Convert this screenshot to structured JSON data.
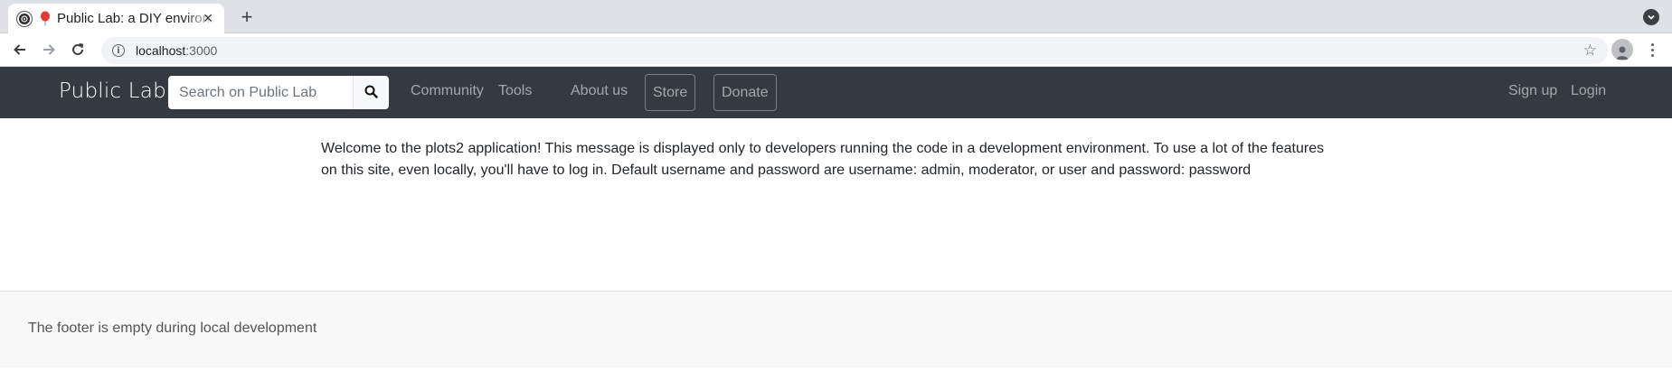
{
  "browser": {
    "tab": {
      "title": "Public Lab: a DIY environmental science community"
    },
    "address_bar": {
      "host": "localhost",
      "port": ":3000"
    }
  },
  "navbar": {
    "brand": "Public Lab",
    "search": {
      "placeholder": "Search on Public Lab"
    },
    "links": {
      "community": "Community",
      "tools": "Tools",
      "about": "About us",
      "store": "Store",
      "donate": "Donate",
      "signup": "Sign up",
      "login": "Login"
    }
  },
  "main": {
    "dev_message_line1": "Welcome to the plots2 application! This message is displayed only to developers running the code in a development environment. To use a lot of the features",
    "dev_message_line2": "on this site, even locally, you'll have to log in. Default username and password are username: admin, moderator, or user and password: password"
  },
  "footer": {
    "text": "The footer is empty during local development"
  },
  "colors": {
    "navbar_bg": "#343a40",
    "footer_bg": "#f8f8f8",
    "tab_favicon_accent": "#e53935"
  }
}
